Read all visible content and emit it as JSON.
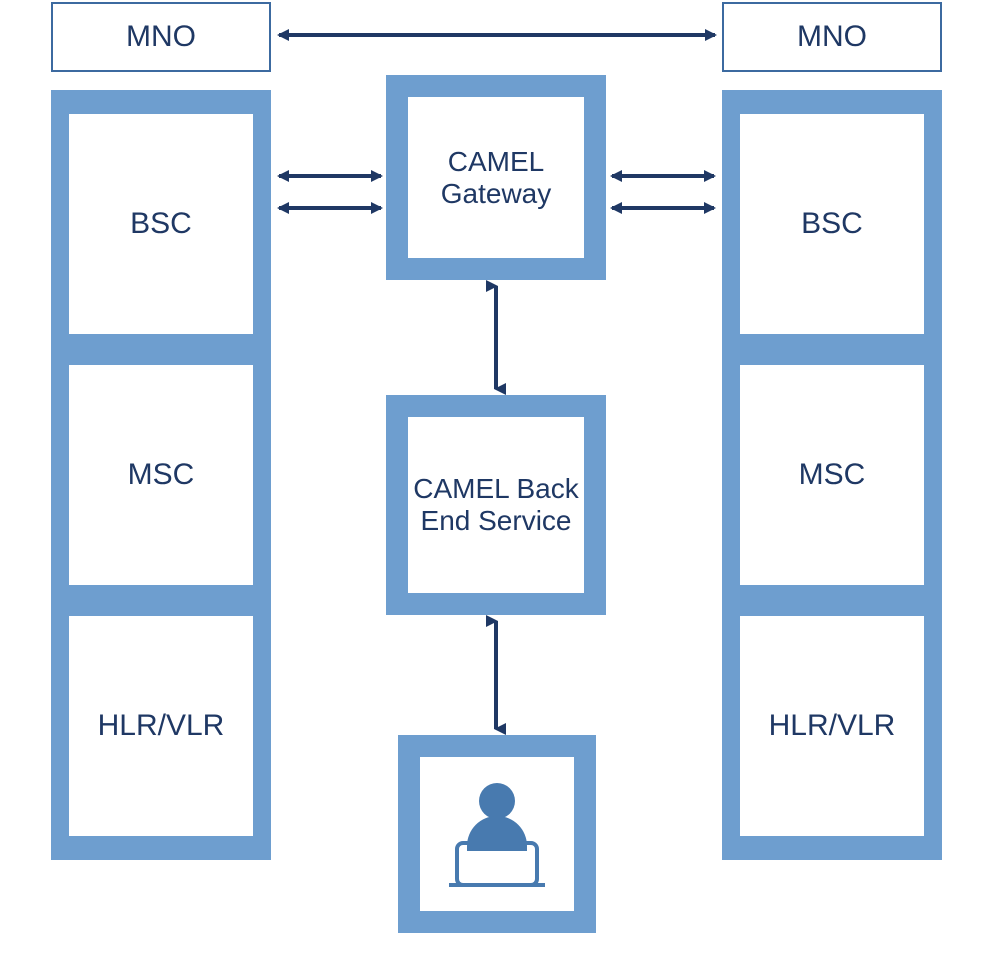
{
  "colors": {
    "darkBlue": "#1f3864",
    "midBlue": "#6e9ecf",
    "borderBlue": "#3c6aa0",
    "iconBlue": "#487aaf"
  },
  "left": {
    "header": "MNO",
    "cells": [
      "BSC",
      "MSC",
      "HLR/VLR"
    ]
  },
  "right": {
    "header": "MNO",
    "cells": [
      "BSC",
      "MSC",
      "HLR/VLR"
    ]
  },
  "center": {
    "gateway": "CAMEL Gateway",
    "backend": "CAMEL Back End Service"
  }
}
